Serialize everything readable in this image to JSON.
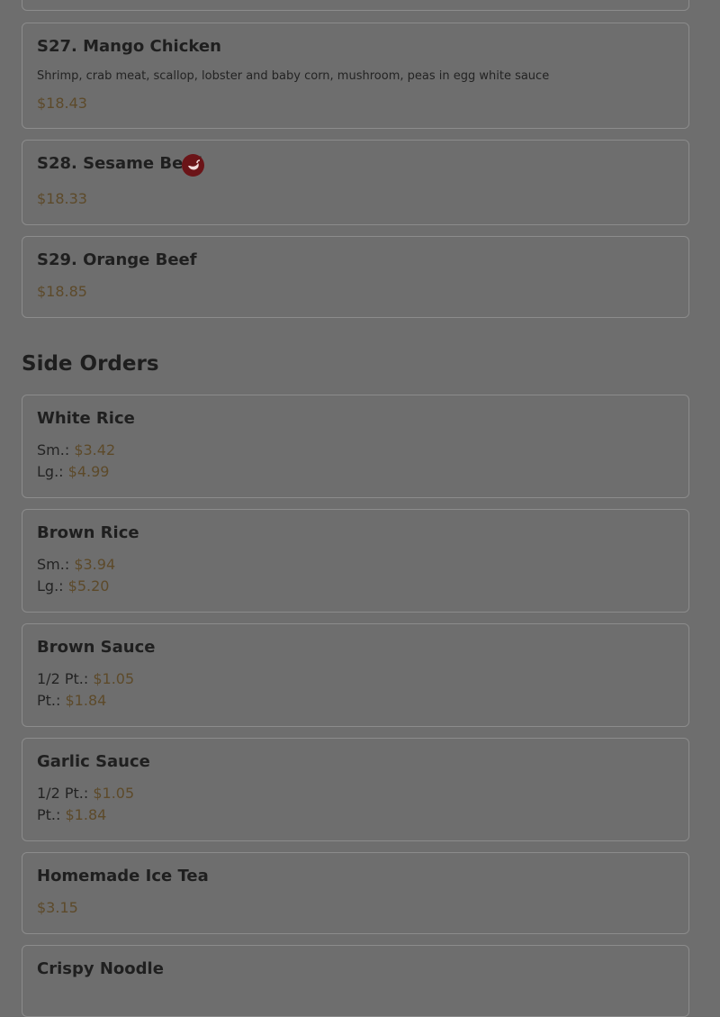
{
  "menu_items": [
    {
      "title": "S27. Mango Chicken",
      "description": "Shrimp, crab meat, scallop, lobster and baby corn, mushroom, peas in egg white sauce",
      "price": "$18.43"
    },
    {
      "title": "S28. Sesame Beef",
      "price": "$18.33",
      "icon": "chili-pepper-icon"
    },
    {
      "title": "S29. Orange Beef",
      "price": "$18.85"
    }
  ],
  "side_orders": {
    "heading": "Side Orders",
    "items": [
      {
        "title": "White Rice",
        "prices": [
          {
            "label": "Sm.:",
            "price": "$3.42"
          },
          {
            "label": "Lg.:",
            "price": "$4.99"
          }
        ]
      },
      {
        "title": "Brown Rice",
        "prices": [
          {
            "label": "Sm.:",
            "price": "$3.94"
          },
          {
            "label": "Lg.:",
            "price": "$5.20"
          }
        ]
      },
      {
        "title": "Brown Sauce",
        "prices": [
          {
            "label": "1/2 Pt.:",
            "price": "$1.05"
          },
          {
            "label": "Pt.:",
            "price": "$1.84"
          }
        ]
      },
      {
        "title": "Garlic Sauce",
        "prices": [
          {
            "label": "1/2 Pt.:",
            "price": "$1.05"
          },
          {
            "label": "Pt.:",
            "price": "$1.84"
          }
        ]
      },
      {
        "title": "Homemade Ice Tea",
        "price": "$3.15"
      },
      {
        "title": "Crispy Noodle"
      }
    ]
  },
  "colors": {
    "overlay_bg": "#6e6e6e",
    "price": "#5d4a2a",
    "spicy_badge": "#6b1418"
  }
}
